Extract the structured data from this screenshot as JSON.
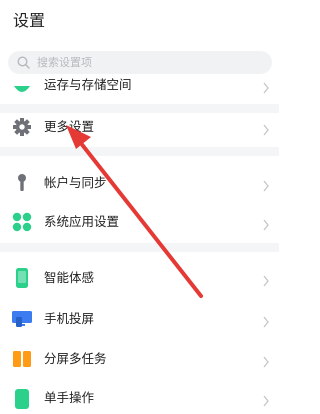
{
  "header": {
    "title": "设置"
  },
  "search": {
    "placeholder": "搜索设置项",
    "icon": "search-icon"
  },
  "menu": {
    "items": [
      {
        "label": "运存与存储空间",
        "icon": "storage-icon",
        "color": "#2bd08a"
      },
      {
        "label": "更多设置",
        "icon": "gear-icon",
        "color": "#6e7178"
      },
      {
        "label": "帐户与同步",
        "icon": "key-icon",
        "color": "#6e7178"
      },
      {
        "label": "系统应用设置",
        "icon": "apps-icon",
        "color": "#2bd08a"
      },
      {
        "label": "智能体感",
        "icon": "phone-icon",
        "color": "#2bd08a"
      },
      {
        "label": "手机投屏",
        "icon": "screencast-icon",
        "color": "#3d7bf0"
      },
      {
        "label": "分屏多任务",
        "icon": "split-screen-icon",
        "color": "#ff9b14"
      },
      {
        "label": "单手操作",
        "icon": "one-hand-icon",
        "color": "#2bd08a"
      }
    ]
  },
  "annotation": {
    "type": "red-arrow",
    "color": "#e53935"
  }
}
